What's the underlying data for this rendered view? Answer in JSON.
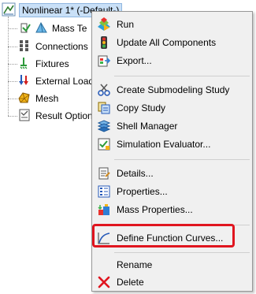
{
  "tree": {
    "root_label": "Nonlinear 1* (-Default-)",
    "items": [
      {
        "label": "Mass Te",
        "icon": "part-body-icon"
      },
      {
        "label": "Connections",
        "icon": "connections-icon"
      },
      {
        "label": "Fixtures",
        "icon": "fixtures-icon"
      },
      {
        "label": "External Load",
        "icon": "external-loads-icon"
      },
      {
        "label": "Mesh",
        "icon": "mesh-icon"
      },
      {
        "label": "Result Option",
        "icon": "result-options-icon"
      }
    ]
  },
  "menu": {
    "items": [
      {
        "label": "Run",
        "icon": "run-icon"
      },
      {
        "label": "Update All Components",
        "icon": "update-components-icon"
      },
      {
        "label": "Export...",
        "icon": "export-icon"
      },
      {
        "label": "Create Submodeling Study",
        "icon": "submodeling-icon"
      },
      {
        "label": "Copy Study",
        "icon": "copy-study-icon"
      },
      {
        "label": "Shell Manager",
        "icon": "shell-manager-icon"
      },
      {
        "label": "Simulation Evaluator...",
        "icon": "simulation-evaluator-icon"
      },
      {
        "label": "Details...",
        "icon": "details-icon"
      },
      {
        "label": "Properties...",
        "icon": "properties-icon"
      },
      {
        "label": "Mass Properties...",
        "icon": "mass-properties-icon"
      },
      {
        "label": "Define Function Curves...",
        "icon": "function-curve-icon"
      },
      {
        "label": "Rename",
        "icon": ""
      },
      {
        "label": "Delete",
        "icon": "delete-icon"
      }
    ]
  },
  "colors": {
    "highlight_border": "#e0151f",
    "menu_background": "#f0f0f0",
    "selection_background": "#c9e0f7"
  }
}
